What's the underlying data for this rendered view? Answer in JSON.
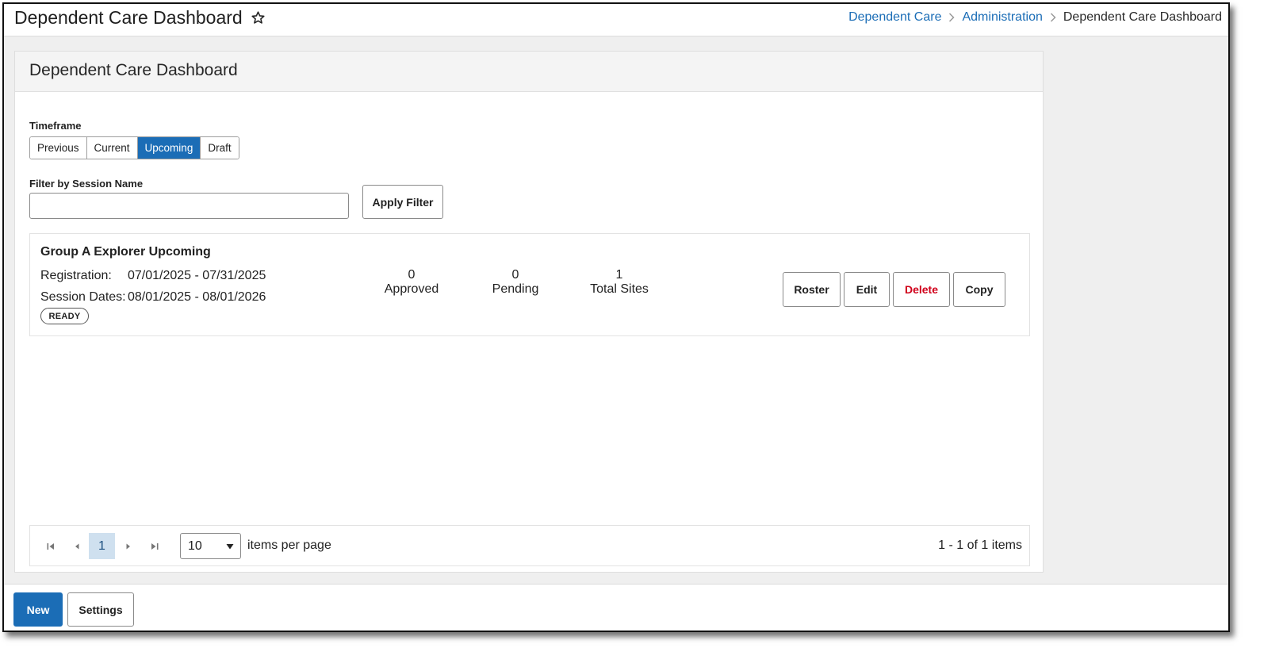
{
  "header": {
    "title": "Dependent Care Dashboard",
    "breadcrumb": [
      "Dependent Care",
      "Administration",
      "Dependent Care Dashboard"
    ]
  },
  "panel": {
    "title": "Dependent Care Dashboard",
    "timeframe_label": "Timeframe",
    "timeframe_options": [
      "Previous",
      "Current",
      "Upcoming",
      "Draft"
    ],
    "timeframe_selected": "Upcoming",
    "filter_label": "Filter by Session Name",
    "filter_value": "",
    "apply_filter_label": "Apply Filter"
  },
  "session": {
    "name": "Group A Explorer Upcoming",
    "registration_label": "Registration:",
    "registration_value": "07/01/2025 - 07/31/2025",
    "session_dates_label": "Session Dates:",
    "session_dates_value": "08/01/2025 - 08/01/2026",
    "status": "READY",
    "stats": [
      {
        "value": "0",
        "label": "Approved"
      },
      {
        "value": "0",
        "label": "Pending"
      },
      {
        "value": "1",
        "label": "Total Sites"
      }
    ],
    "actions": [
      "Roster",
      "Edit",
      "Delete",
      "Copy"
    ]
  },
  "pager": {
    "current_page": "1",
    "page_size": "10",
    "items_per_page_label": "items per page",
    "summary": "1 - 1 of 1 items"
  },
  "footer": {
    "new_label": "New",
    "settings_label": "Settings"
  },
  "colors": {
    "accent": "#1b6db6",
    "danger": "#d0021b",
    "page_bg": "#efefef"
  },
  "icons": [
    "star-icon",
    "chevron-right-icon",
    "first-page-icon",
    "prev-page-icon",
    "next-page-icon",
    "last-page-icon",
    "caret-down-icon"
  ]
}
